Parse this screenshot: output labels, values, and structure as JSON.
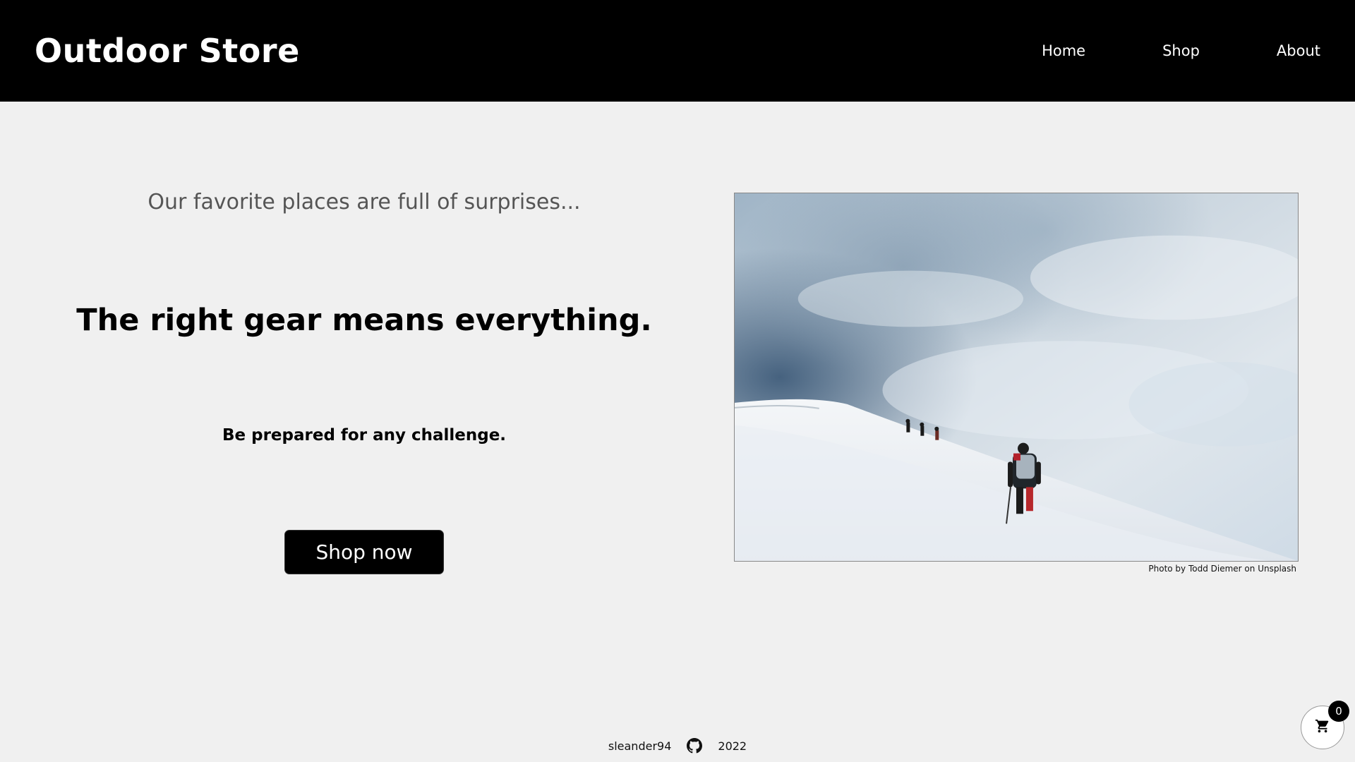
{
  "header": {
    "brand": "Outdoor Store",
    "nav": [
      {
        "label": "Home"
      },
      {
        "label": "Shop"
      },
      {
        "label": "About"
      }
    ]
  },
  "hero": {
    "tagline": "Our favorite places are full of surprises...",
    "headline": "The right gear means everything.",
    "subhead": "Be prepared for any challenge.",
    "cta_label": "Shop now",
    "photo_credit": "Photo by Todd Diemer on Unsplash"
  },
  "footer": {
    "author": "sleander94",
    "icon": "github-icon",
    "year": "2022"
  },
  "cart": {
    "icon": "cart-icon",
    "count": "0"
  },
  "colors": {
    "header_bg": "#000000",
    "page_bg": "#f0f0f0",
    "button_bg": "#000000"
  }
}
